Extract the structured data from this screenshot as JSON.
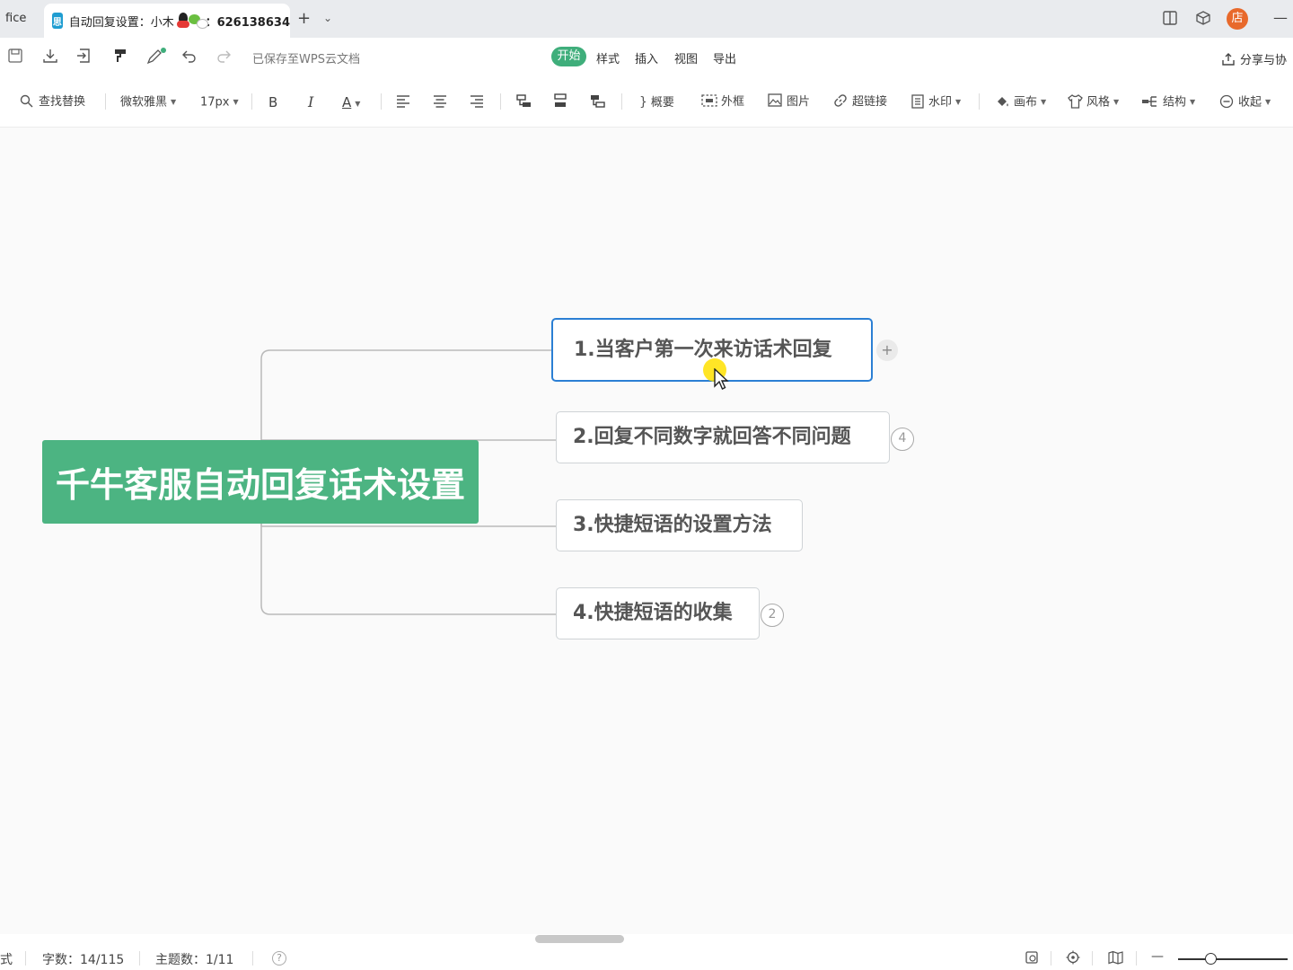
{
  "titlebar": {
    "prev_tab_label": "fice",
    "active_tab": {
      "title": "自动回复设置：小木",
      "suffix": "：626138634",
      "logo_text": "思"
    },
    "new_tab_symbol": "+",
    "avatar_text": "店"
  },
  "menubar": {
    "saved_status": "已保存至WPS云文档",
    "menus": [
      "开始",
      "样式",
      "插入",
      "视图",
      "导出"
    ],
    "share_label": "分享与协"
  },
  "toolbar": {
    "find_replace": "查找替换",
    "font_family": "微软雅黑",
    "font_size": "17px",
    "bold": "B",
    "italic": "I",
    "font_color": "A",
    "summary": "概要",
    "frame": "外框",
    "image": "图片",
    "hyperlink": "超链接",
    "watermark": "水印",
    "canvas": "画布",
    "style": "风格",
    "structure": "结构",
    "collapse": "收起"
  },
  "mindmap": {
    "root": "千牛客服自动回复话术设置",
    "topics": [
      {
        "label": "1.当客户第一次来访话术回复",
        "badge": ""
      },
      {
        "label": "2.回复不同数字就回答不同问题",
        "badge": "4"
      },
      {
        "label": "3.快捷短语的设置方法",
        "badge": ""
      },
      {
        "label": "4.快捷短语的收集",
        "badge": "2"
      }
    ],
    "add_symbol": "+"
  },
  "statusbar": {
    "mode_fragment": "式",
    "word_count": "字数：14/115",
    "topic_count": "主题数：1/11",
    "help": "?",
    "zoom_minus": "—"
  },
  "colors": {
    "accent_green": "#4cb482",
    "menu_active_green": "#3fae7b",
    "selection_blue": "#2b7fd4"
  }
}
